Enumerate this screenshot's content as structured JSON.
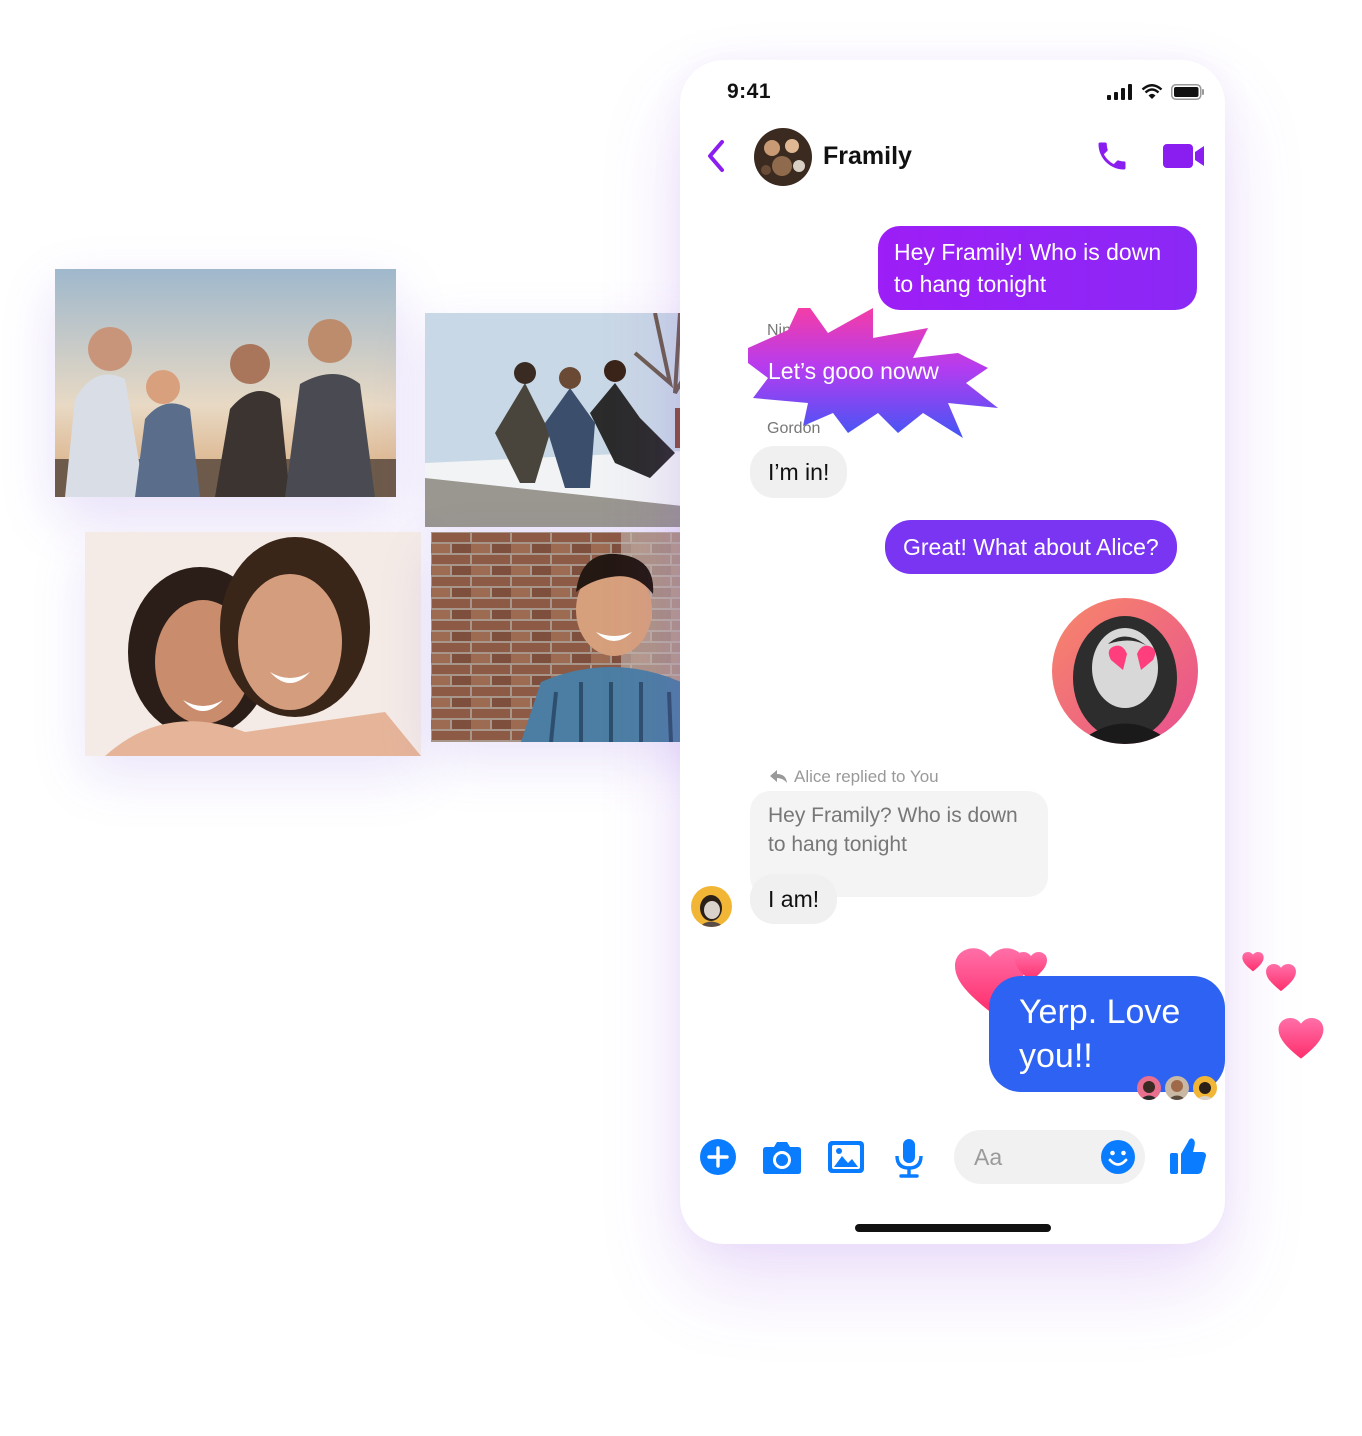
{
  "status_bar": {
    "time": "9:41"
  },
  "header": {
    "back": "back-icon",
    "title": "Framily",
    "call": "phone-icon",
    "video": "video-camera-icon"
  },
  "messages": {
    "outgoing_1": "Hey Framily! Who is down to hang tonight",
    "ning": {
      "sender": "Ning",
      "text": "Let’s gooo noww"
    },
    "gordon": {
      "sender": "Gordon",
      "text": "I’m in!"
    },
    "outgoing_2": "Great! What about Alice?",
    "reply": {
      "label": "Alice replied to You",
      "quoted": "Hey Framily? Who is down to hang tonight",
      "text": "I am!"
    },
    "outgoing_3": "Yerp. Love you!!"
  },
  "composer": {
    "placeholder": "Aa",
    "icons": [
      "plus-icon",
      "camera-icon",
      "image-icon",
      "microphone-icon",
      "emoji-icon",
      "thumbs-up-icon"
    ]
  },
  "colors": {
    "purple": "#9d1ef6",
    "violet": "#7a35f3",
    "blue": "#2d62f2",
    "messenger_blue": "#0a7cff",
    "heart_pink": "#ff4f8b"
  }
}
